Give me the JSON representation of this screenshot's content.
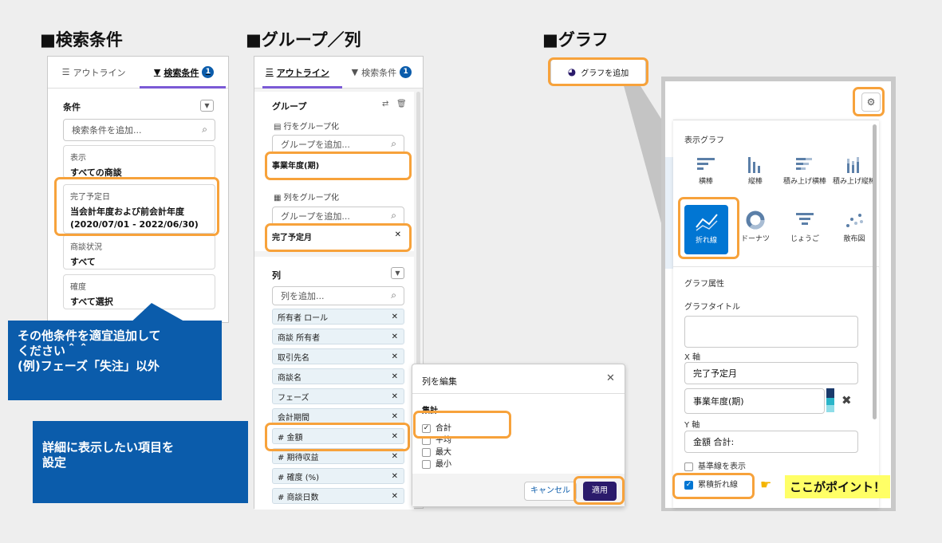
{
  "sections": {
    "search": "■検索条件",
    "group": "■グループ／列",
    "graph": "■グラフ"
  },
  "left_panel": {
    "tab_outline": "アウトライン",
    "tab_filter": "検索条件",
    "tab_badge": "1",
    "conditions_label": "条件",
    "search_placeholder": "検索条件を追加...",
    "cards": [
      {
        "label": "表示",
        "value": "すべての商談"
      },
      {
        "label": "完了予定日",
        "value": "当会計年度および前会計年度",
        "value2": "(2020/07/01 - 2022/06/30)"
      },
      {
        "label": "商談状況",
        "value": "すべて"
      },
      {
        "label": "確度",
        "value": "すべて選択"
      }
    ]
  },
  "callout_filter": {
    "line1": "その他条件を適宜追加して",
    "line2": "ください＾＾",
    "line3": "(例)フェーズ「失注」以外"
  },
  "callout_columns": {
    "line1": "詳細に表示したい項目を",
    "line2": "設定"
  },
  "mid_panel": {
    "tab_outline": "アウトライン",
    "tab_filter": "検索条件",
    "tab_badge": "1",
    "group_label": "グループ",
    "row_group_label": "行をグループ化",
    "group_placeholder": "グループを追加...",
    "row_group_value": "事業年度(期)",
    "col_group_label": "列をグループ化",
    "col_group_value": "完了予定月",
    "columns_label": "列",
    "col_placeholder": "列を追加...",
    "columns": [
      "所有者 ロール",
      "商談 所有者",
      "取引先名",
      "商談名",
      "フェーズ",
      "会計期間",
      "# 金額",
      "# 期待収益",
      "# 確度 (%)",
      "# 商談日数"
    ]
  },
  "edit_popup": {
    "title": "列を編集",
    "aggregate_label": "集計",
    "options": [
      {
        "label": "合計",
        "checked": true
      },
      {
        "label": "平均",
        "checked": false
      },
      {
        "label": "最大",
        "checked": false
      },
      {
        "label": "最小",
        "checked": false
      }
    ],
    "cancel": "キャンセル",
    "apply": "適用"
  },
  "graph": {
    "add_button": "グラフを追加",
    "display_graph_label": "表示グラフ",
    "chart_types": [
      {
        "label": "横棒",
        "icon": "horizontal-bar-icon"
      },
      {
        "label": "縦棒",
        "icon": "vertical-bar-icon"
      },
      {
        "label": "積み上げ横棒",
        "icon": "stacked-horizontal-bar-icon"
      },
      {
        "label": "積み上げ縦棒",
        "icon": "stacked-vertical-bar-icon"
      },
      {
        "label": "折れ線",
        "icon": "line-chart-icon",
        "selected": true
      },
      {
        "label": "ドーナツ",
        "icon": "donut-icon"
      },
      {
        "label": "じょうご",
        "icon": "funnel-icon"
      },
      {
        "label": "散布図",
        "icon": "scatter-icon"
      }
    ],
    "attributes_label": "グラフ属性",
    "title_label": "グラフタイトル",
    "title_value": "",
    "x_axis_label": "X 軸",
    "x_axis_value": "完了予定月",
    "x_axis_value2": "事業年度(期)",
    "y_axis_label": "Y 軸",
    "y_axis_value": "金額 合計:",
    "baseline_label": "基準線を表示",
    "baseline_checked": false,
    "cumulative_label": "累積折れ線",
    "cumulative_checked": true,
    "point_text": "ここがポイント！",
    "colors": {
      "accent": "#0176d3",
      "highlight": "#f7a23b",
      "note_bg": "#ffff66"
    }
  }
}
